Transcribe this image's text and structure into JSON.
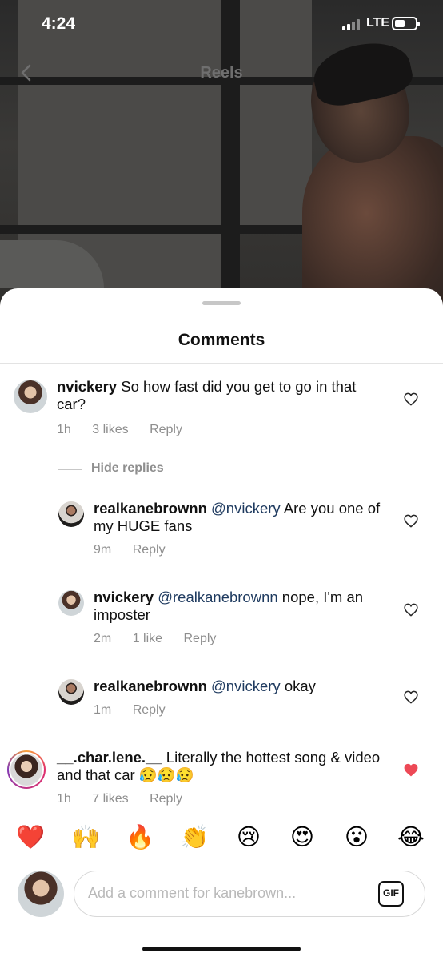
{
  "status_bar": {
    "time": "4:24",
    "network": "LTE",
    "battery_level": 0.5
  },
  "header": {
    "title": "Reels"
  },
  "sheet": {
    "title": "Comments"
  },
  "comments": [
    {
      "username": "nvickery",
      "text": "So how fast did you get to go in that car?",
      "time": "1h",
      "likes": "3 likes",
      "reply": "Reply",
      "liked": false
    },
    {
      "username": "realkanebrownn",
      "mention": "@nvickery",
      "text": "Are you one of my HUGE fans",
      "time": "9m",
      "reply": "Reply",
      "liked": false
    },
    {
      "username": "nvickery",
      "mention": "@realkanebrownn",
      "text": "nope, I'm an imposter",
      "time": "2m",
      "likes": "1 like",
      "reply": "Reply",
      "liked": false
    },
    {
      "username": "realkanebrownn",
      "mention": "@nvickery",
      "text": "okay",
      "time": "1m",
      "reply": "Reply",
      "liked": false
    },
    {
      "username": "__.char.lene.__",
      "text": "Literally the hottest song & video and that car 😥😥😥",
      "time": "1h",
      "likes": "7 likes",
      "reply": "Reply",
      "liked": true
    }
  ],
  "replies_toggle": "Hide replies",
  "emoji_bar": [
    "❤️",
    "🙌",
    "🔥",
    "👏",
    "😢",
    "😍",
    "😮",
    "😂"
  ],
  "composer": {
    "placeholder": "Add a comment for kanebrown...",
    "gif_label": "GIF"
  },
  "colors": {
    "like_red": "#ed4956",
    "mention_blue": "#1e3a5f",
    "meta_gray": "#8e8e8e"
  }
}
